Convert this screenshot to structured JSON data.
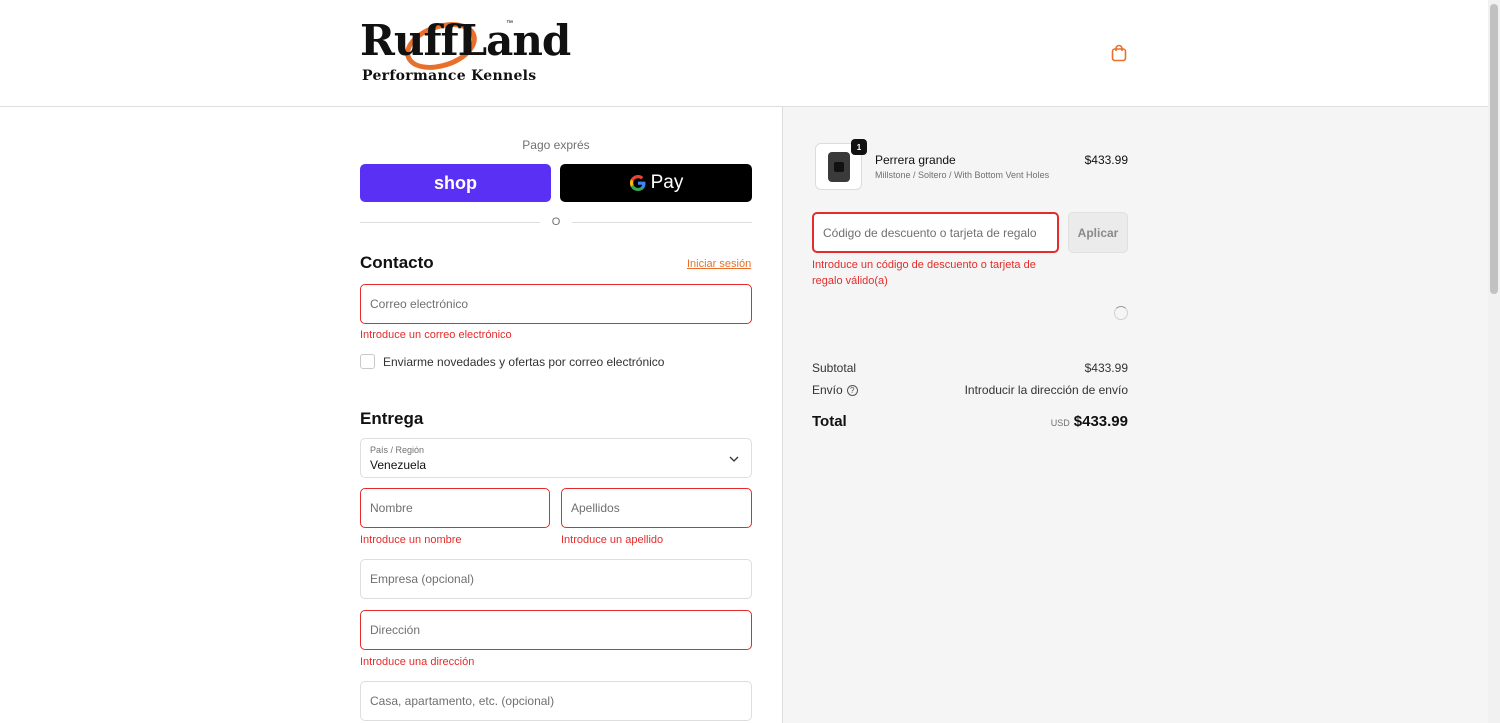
{
  "brand": {
    "logo_top": "RuffLand",
    "logo_tm": "™",
    "logo_bottom": "Performance Kennels"
  },
  "express": {
    "title": "Pago exprés",
    "shop_label": "shop",
    "gpay_label": "Pay",
    "divider": "O"
  },
  "contact": {
    "title": "Contacto",
    "login_link": "Iniciar sesión",
    "email_placeholder": "Correo electrónico",
    "email_error": "Introduce un correo electrónico",
    "newsletter_label": "Enviarme novedades y ofertas por correo electrónico"
  },
  "delivery": {
    "title": "Entrega",
    "country_label": "País / Región",
    "country_value": "Venezuela",
    "first_name_placeholder": "Nombre",
    "first_name_error": "Introduce un nombre",
    "last_name_placeholder": "Apellidos",
    "last_name_error": "Introduce un apellido",
    "company_placeholder": "Empresa (opcional)",
    "address_placeholder": "Dirección",
    "address_error": "Introduce una dirección",
    "apartment_placeholder": "Casa, apartamento, etc. (opcional)"
  },
  "summary": {
    "product": {
      "name": "Perrera grande",
      "variant": "Millstone / Soltero / With Bottom Vent Holes",
      "price": "$433.99",
      "quantity": "1"
    },
    "discount_placeholder": "Código de descuento o tarjeta de regalo",
    "apply_label": "Aplicar",
    "discount_error": "Introduce un código de descuento o tarjeta de regalo válido(a)",
    "subtotal_label": "Subtotal",
    "subtotal_value": "$433.99",
    "shipping_label": "Envío",
    "shipping_value": "Introducir la dirección de envío",
    "total_label": "Total",
    "total_currency": "USD",
    "total_value": "$433.99"
  },
  "colors": {
    "accent": "#e8702a",
    "error": "#e32c2b",
    "shop_pay": "#5a31f4"
  }
}
